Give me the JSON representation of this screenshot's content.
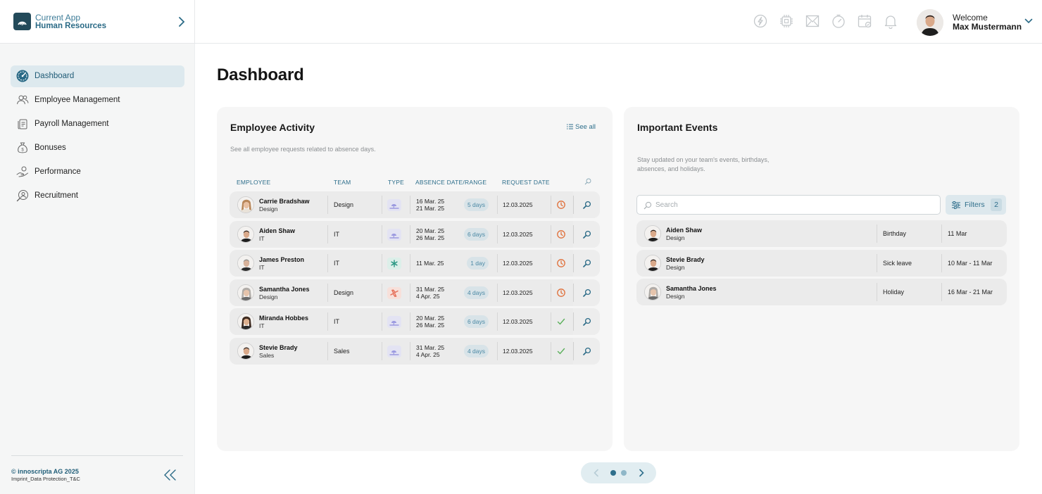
{
  "header": {
    "app_label": "Current App",
    "app_name": "Human Resources",
    "welcome": "Welcome",
    "user_name": "Max Mustermann",
    "icons": [
      "chat-bolt-icon",
      "chip-icon",
      "mail-icon",
      "clock-icon",
      "calendar-icon",
      "bell-icon"
    ]
  },
  "sidebar": {
    "items": [
      {
        "label": "Dashboard",
        "icon": "dashboard-gauge-icon",
        "active": true
      },
      {
        "label": "Employee Management",
        "icon": "people-icon"
      },
      {
        "label": "Payroll Management",
        "icon": "documents-icon"
      },
      {
        "label": "Bonuses",
        "icon": "money-bag-icon"
      },
      {
        "label": "Performance",
        "icon": "hand-coins-icon"
      },
      {
        "label": "Recruitment",
        "icon": "user-search-icon"
      }
    ],
    "copyright": "© innoscripta AG 2025",
    "imprint": "Imprint_Data Protection_T&C"
  },
  "main": {
    "title": "Dashboard"
  },
  "activity": {
    "title": "Employee Activity",
    "see_all": "See all",
    "subtitle": "See all employee requests related to absence days.",
    "columns": {
      "employee": "Employee",
      "team": "Team",
      "type": "Type",
      "absence": "Absence Date/Range",
      "request": "Request Date"
    },
    "rows": [
      {
        "name": "Carrie Bradshaw",
        "team": "Design",
        "team_col": "Design",
        "type": "vacation",
        "d1": "16 Mar. 25",
        "d2": "21 Mar. 25",
        "days": "5 days",
        "req": "12.03.2025",
        "status": "pending"
      },
      {
        "name": "Aiden Shaw",
        "team": "IT",
        "team_col": "IT",
        "type": "vacation",
        "d1": "20 Mar. 25",
        "d2": "26 Mar. 25",
        "days": "6 days",
        "req": "12.03.2025",
        "status": "pending"
      },
      {
        "name": "James Preston",
        "team": "IT",
        "team_col": "IT",
        "type": "sick",
        "d1": "11 Mar. 25",
        "d2": "",
        "days": "1 day",
        "req": "12.03.2025",
        "status": "pending"
      },
      {
        "name": "Samantha Jones",
        "team": "Design",
        "team_col": "Design",
        "type": "travel",
        "d1": "31 Mar. 25",
        "d2": "4 Apr. 25",
        "days": "4 days",
        "req": "12.03.2025",
        "status": "pending"
      },
      {
        "name": "Miranda Hobbes",
        "team": "IT",
        "team_col": "IT",
        "type": "vacation",
        "d1": "20 Mar. 25",
        "d2": "26 Mar. 25",
        "days": "6 days",
        "req": "12.03.2025",
        "status": "approved"
      },
      {
        "name": "Stevie Brady",
        "team": "Sales",
        "team_col": "Sales",
        "type": "vacation",
        "d1": "31 Mar. 25",
        "d2": "4 Apr. 25",
        "days": "4 days",
        "req": "12.03.2025",
        "status": "approved"
      }
    ]
  },
  "events": {
    "title": "Important Events",
    "subtitle_1": "Stay updated on your team's events, birthdays,",
    "subtitle_2": "absences, and holidays.",
    "search_placeholder": "Search",
    "filters_label": "Filters",
    "filters_count": "2",
    "rows": [
      {
        "name": "Aiden Shaw",
        "team": "Design",
        "type": "Birthday",
        "date": "11 Mar"
      },
      {
        "name": "Stevie Brady",
        "team": "Design",
        "type": "Sick leave",
        "date": "10 Mar - 11 Mar"
      },
      {
        "name": "Samantha Jones",
        "team": "Design",
        "type": "Holiday",
        "date": "16 Mar - 21 Mar"
      }
    ]
  },
  "pager": {
    "pages": 2,
    "current": 1
  },
  "colors": {
    "accent": "#2e6f8c",
    "active_nav": "#dde9ee",
    "pending": "#e0703a",
    "approved": "#4caf50"
  }
}
